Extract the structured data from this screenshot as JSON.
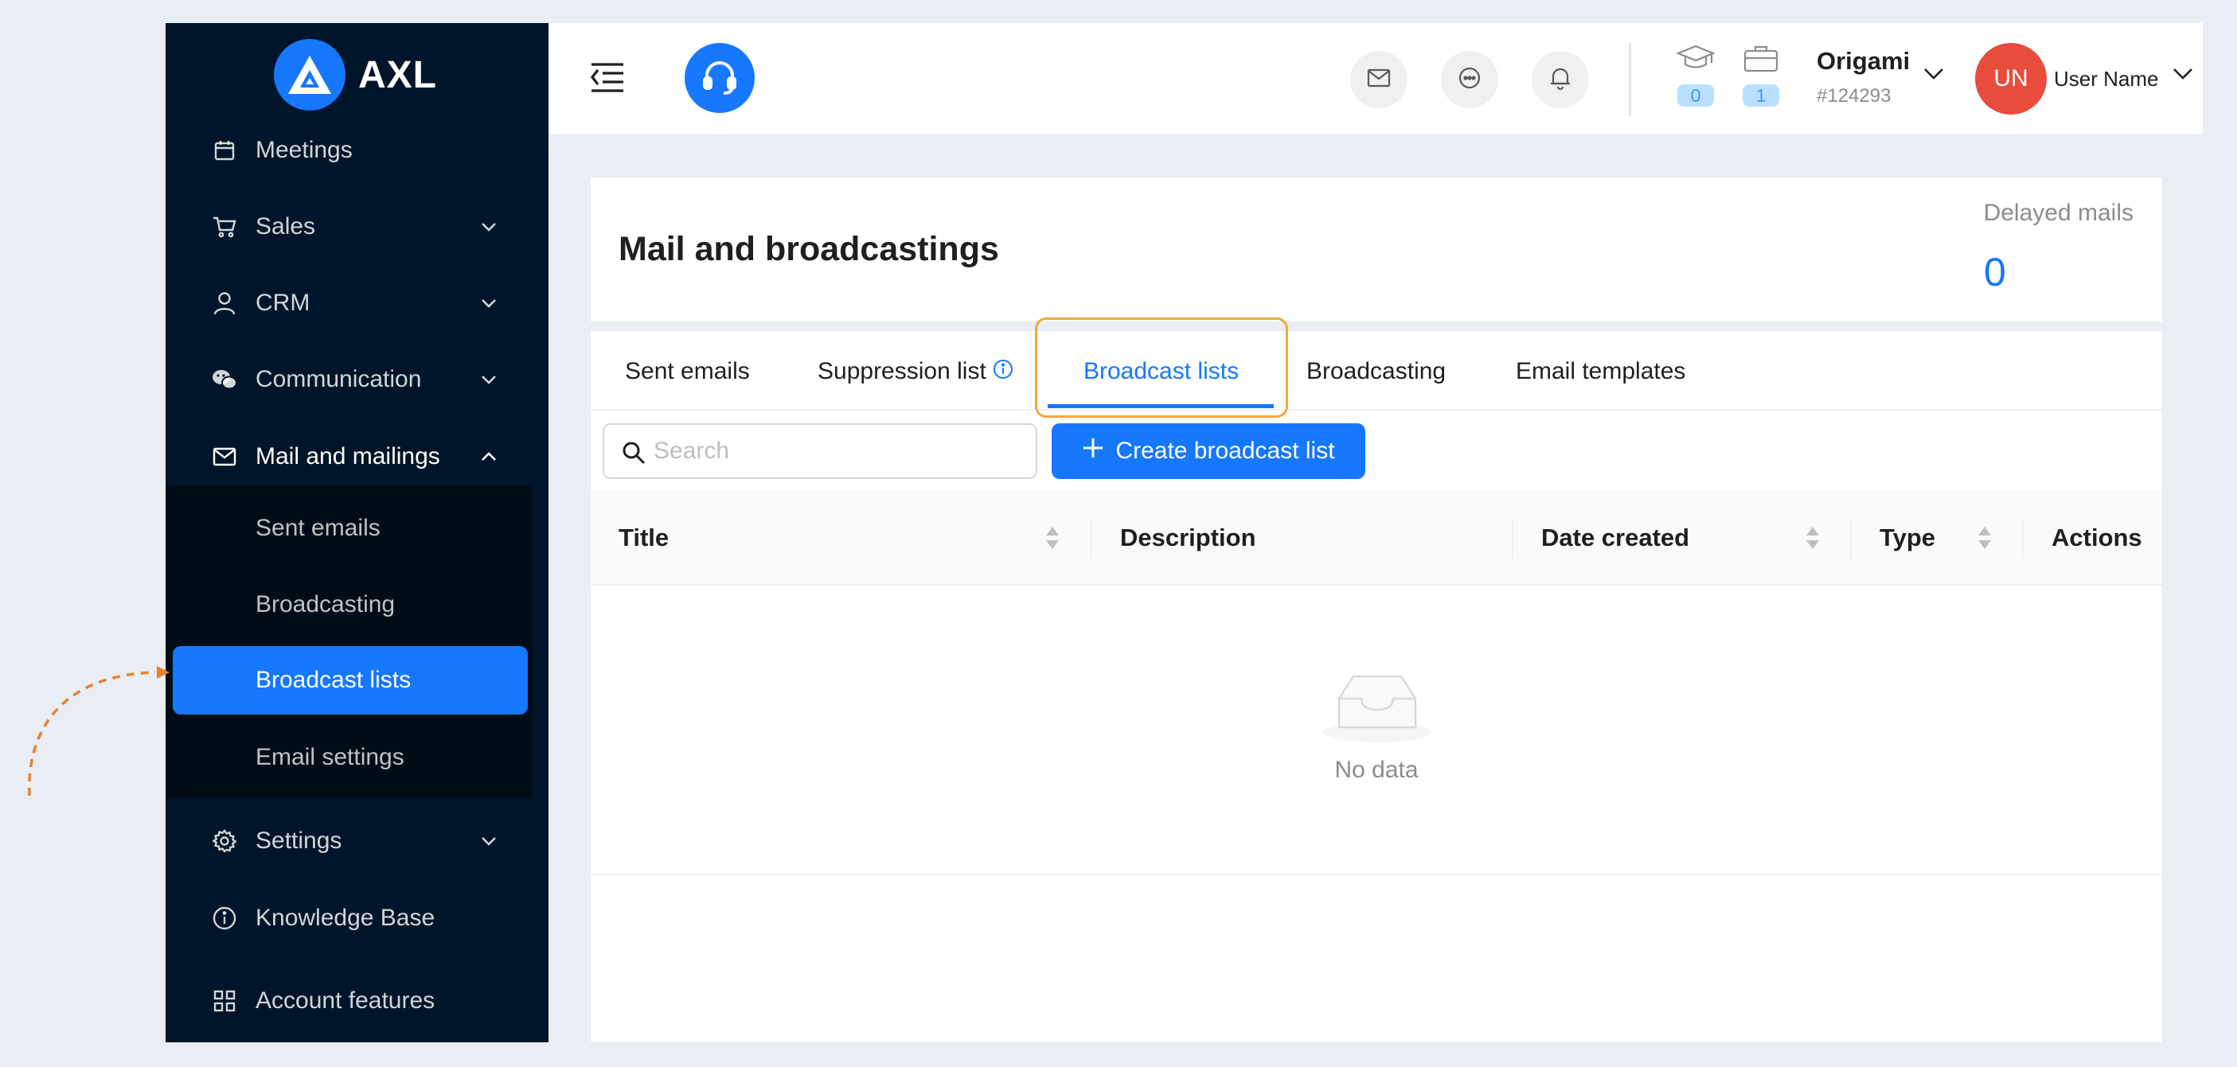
{
  "brand": {
    "name": "AXL"
  },
  "sidebar": {
    "items": [
      {
        "label": "Meetings",
        "icon": "calendar-icon"
      },
      {
        "label": "Sales",
        "icon": "cart-icon"
      },
      {
        "label": "CRM",
        "icon": "user-icon"
      },
      {
        "label": "Communication",
        "icon": "wechat-icon"
      },
      {
        "label": "Mail and mailings",
        "icon": "mail-icon"
      },
      {
        "label": "Settings",
        "icon": "gear-icon"
      },
      {
        "label": "Knowledge Base",
        "icon": "info-icon"
      },
      {
        "label": "Account features",
        "icon": "grid-icon"
      }
    ],
    "submenu": [
      {
        "label": "Sent emails"
      },
      {
        "label": "Broadcasting"
      },
      {
        "label": "Broadcast lists",
        "active": true
      },
      {
        "label": "Email settings"
      }
    ]
  },
  "header": {
    "courses_count": "0",
    "jobs_count": "1",
    "company_name": "Origami",
    "company_id": "#124293",
    "avatar_initials": "UN",
    "user_name": "User Name"
  },
  "page": {
    "title": "Mail and broadcastings",
    "delayed_label": "Delayed mails",
    "delayed_value": "0"
  },
  "tabs": [
    {
      "label": "Sent emails"
    },
    {
      "label": "Suppression list"
    },
    {
      "label": "Broadcast lists",
      "active": true
    },
    {
      "label": "Broadcasting"
    },
    {
      "label": "Email templates"
    }
  ],
  "toolbar": {
    "search_placeholder": "Search",
    "create_label": "Create broadcast list"
  },
  "table": {
    "columns": [
      "Title",
      "Description",
      "Date created",
      "Type",
      "Actions"
    ],
    "empty_text": "No data"
  },
  "colors": {
    "primary": "#1677ff",
    "sidebar_bg": "#001529",
    "highlight": "#f0a93b",
    "avatar": "#e74c3c"
  }
}
